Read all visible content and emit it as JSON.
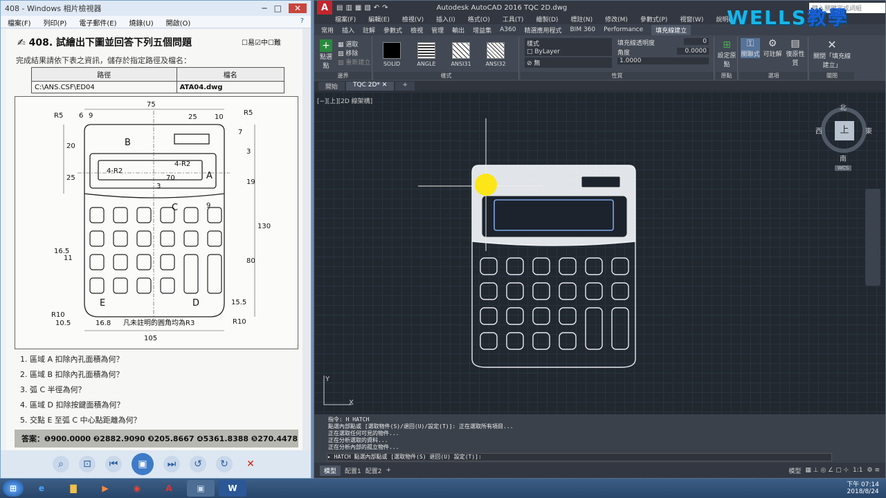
{
  "viewer": {
    "title": "408 - Windows 相片檢視器",
    "menu": [
      "檔案(F)",
      "列印(P)",
      "電子郵件(E)",
      "燒錄(U)",
      "開啟(O)"
    ],
    "question_title": "408. 試繪出下圖並回答下列五個問題",
    "difficulty": [
      "易",
      "中",
      "難"
    ],
    "instruction": "完成結果請依下表之資訊，儲存於指定路徑及檔名：",
    "table_headers": [
      "路徑",
      "檔名"
    ],
    "table_row": [
      "C:\\ANS.CSF\\ED04",
      "ATA04.dwg"
    ],
    "drawing_labels": {
      "top_width": "75",
      "a25": "25",
      "a10": "10",
      "r5a": "R5",
      "r5b": "R5",
      "d6": "6",
      "d9": "9",
      "d7": "7",
      "d3": "3",
      "d20": "20",
      "d25": "25",
      "d19": "19",
      "d130": "130",
      "d80": "80",
      "d16_5": "16.5",
      "d11": "11",
      "d15_5": "15.5",
      "r10a": "R10",
      "r10b": "R10",
      "d10_5": "10.5",
      "d16_8": "16.8",
      "d105": "105",
      "d70": "70",
      "d3b": "3",
      "d9b": "9",
      "r2a": "4-R2",
      "r2b": "4-R2",
      "lblA": "A",
      "lblB": "B",
      "lblC": "C",
      "lblD": "D",
      "lblE": "E",
      "note": "凡未註明的圓角均為R3"
    },
    "questions": [
      "1. 區域 A 扣除內孔面積為何？",
      "2. 區域 B 扣除內孔面積為何？",
      "3. 弧 C 半徑為何？",
      "4. 區域 D 扣除按鍵面積為何？",
      "5. 交點 E 至弧 C 中心點距離為何？"
    ],
    "answer": "答案：❶900.0000 ❷2882.9090 ❸205.8667 ❹5361.8388 ❺270.4478"
  },
  "acad": {
    "title": "Autodesk AutoCAD 2016   TQC 2D.dwg",
    "search_placeholder": "鍵入關鍵字或詞組",
    "menu": [
      "檔案(F)",
      "編輯(E)",
      "檢視(V)",
      "插入(I)",
      "格式(O)",
      "工具(T)",
      "繪製(D)",
      "標註(N)",
      "修改(M)",
      "參數式(P)",
      "視窗(W)",
      "說明(H)"
    ],
    "ribbon_tabs": [
      "常用",
      "插入",
      "註解",
      "參數式",
      "檢視",
      "管理",
      "輸出",
      "增益集",
      "A360",
      "精選應用程式",
      "BIM 360",
      "Performance",
      "填充線建立"
    ],
    "active_tab": "填充線建立",
    "boundary": {
      "pick": "點選點",
      "select": "選取",
      "remove": "移除",
      "recreate": "重新建立",
      "label": "邊界"
    },
    "patterns": [
      "SOLID",
      "ANGLE",
      "ANSI31",
      "ANSI32"
    ],
    "pattern_label": "樣式",
    "props": {
      "type": "樣式",
      "color": "ByLayer",
      "bg": "無",
      "transparency_label": "填充線透明度",
      "transparency": "0",
      "angle_label": "角度",
      "angle": "0.0000",
      "scale": "1.0000",
      "label": "性質"
    },
    "origin": {
      "set": "設定原點",
      "label": "原點"
    },
    "options": {
      "assoc": "關聯式",
      "annot": "可註解",
      "match": "復原性質",
      "label": "選項"
    },
    "close": {
      "btn": "關閉「填充線建立」",
      "label": "關閉"
    },
    "doc_tabs": [
      "開始",
      "TQC 2D*"
    ],
    "view_label": "[−][上][2D 線架構]",
    "viewcube": {
      "n": "北",
      "s": "南",
      "w": "西",
      "e": "東",
      "top": "上",
      "wcs": "WCS"
    },
    "cmd_lines": [
      "指令: H HATCH",
      "點選內部點或 [選取物件(S)/退回(U)/設定(T)]: 正在選取所有項目...",
      "正在選取任何可見的物件...",
      "正在分析選取的資料...",
      "正在分析內部的孤立物件..."
    ],
    "cmd_prompt": "HATCH 點選內部點或 [選取物件(S) 退回(U) 設定(T)]:",
    "status_tabs": [
      "模型",
      "配置1",
      "配置2"
    ],
    "status_model": "模型",
    "status_scale": "1:1"
  },
  "watermark": {
    "latin": "WELLS",
    "zh": "教學"
  },
  "taskbar": {
    "time": "下午 07:14",
    "date": "2018/8/24"
  }
}
